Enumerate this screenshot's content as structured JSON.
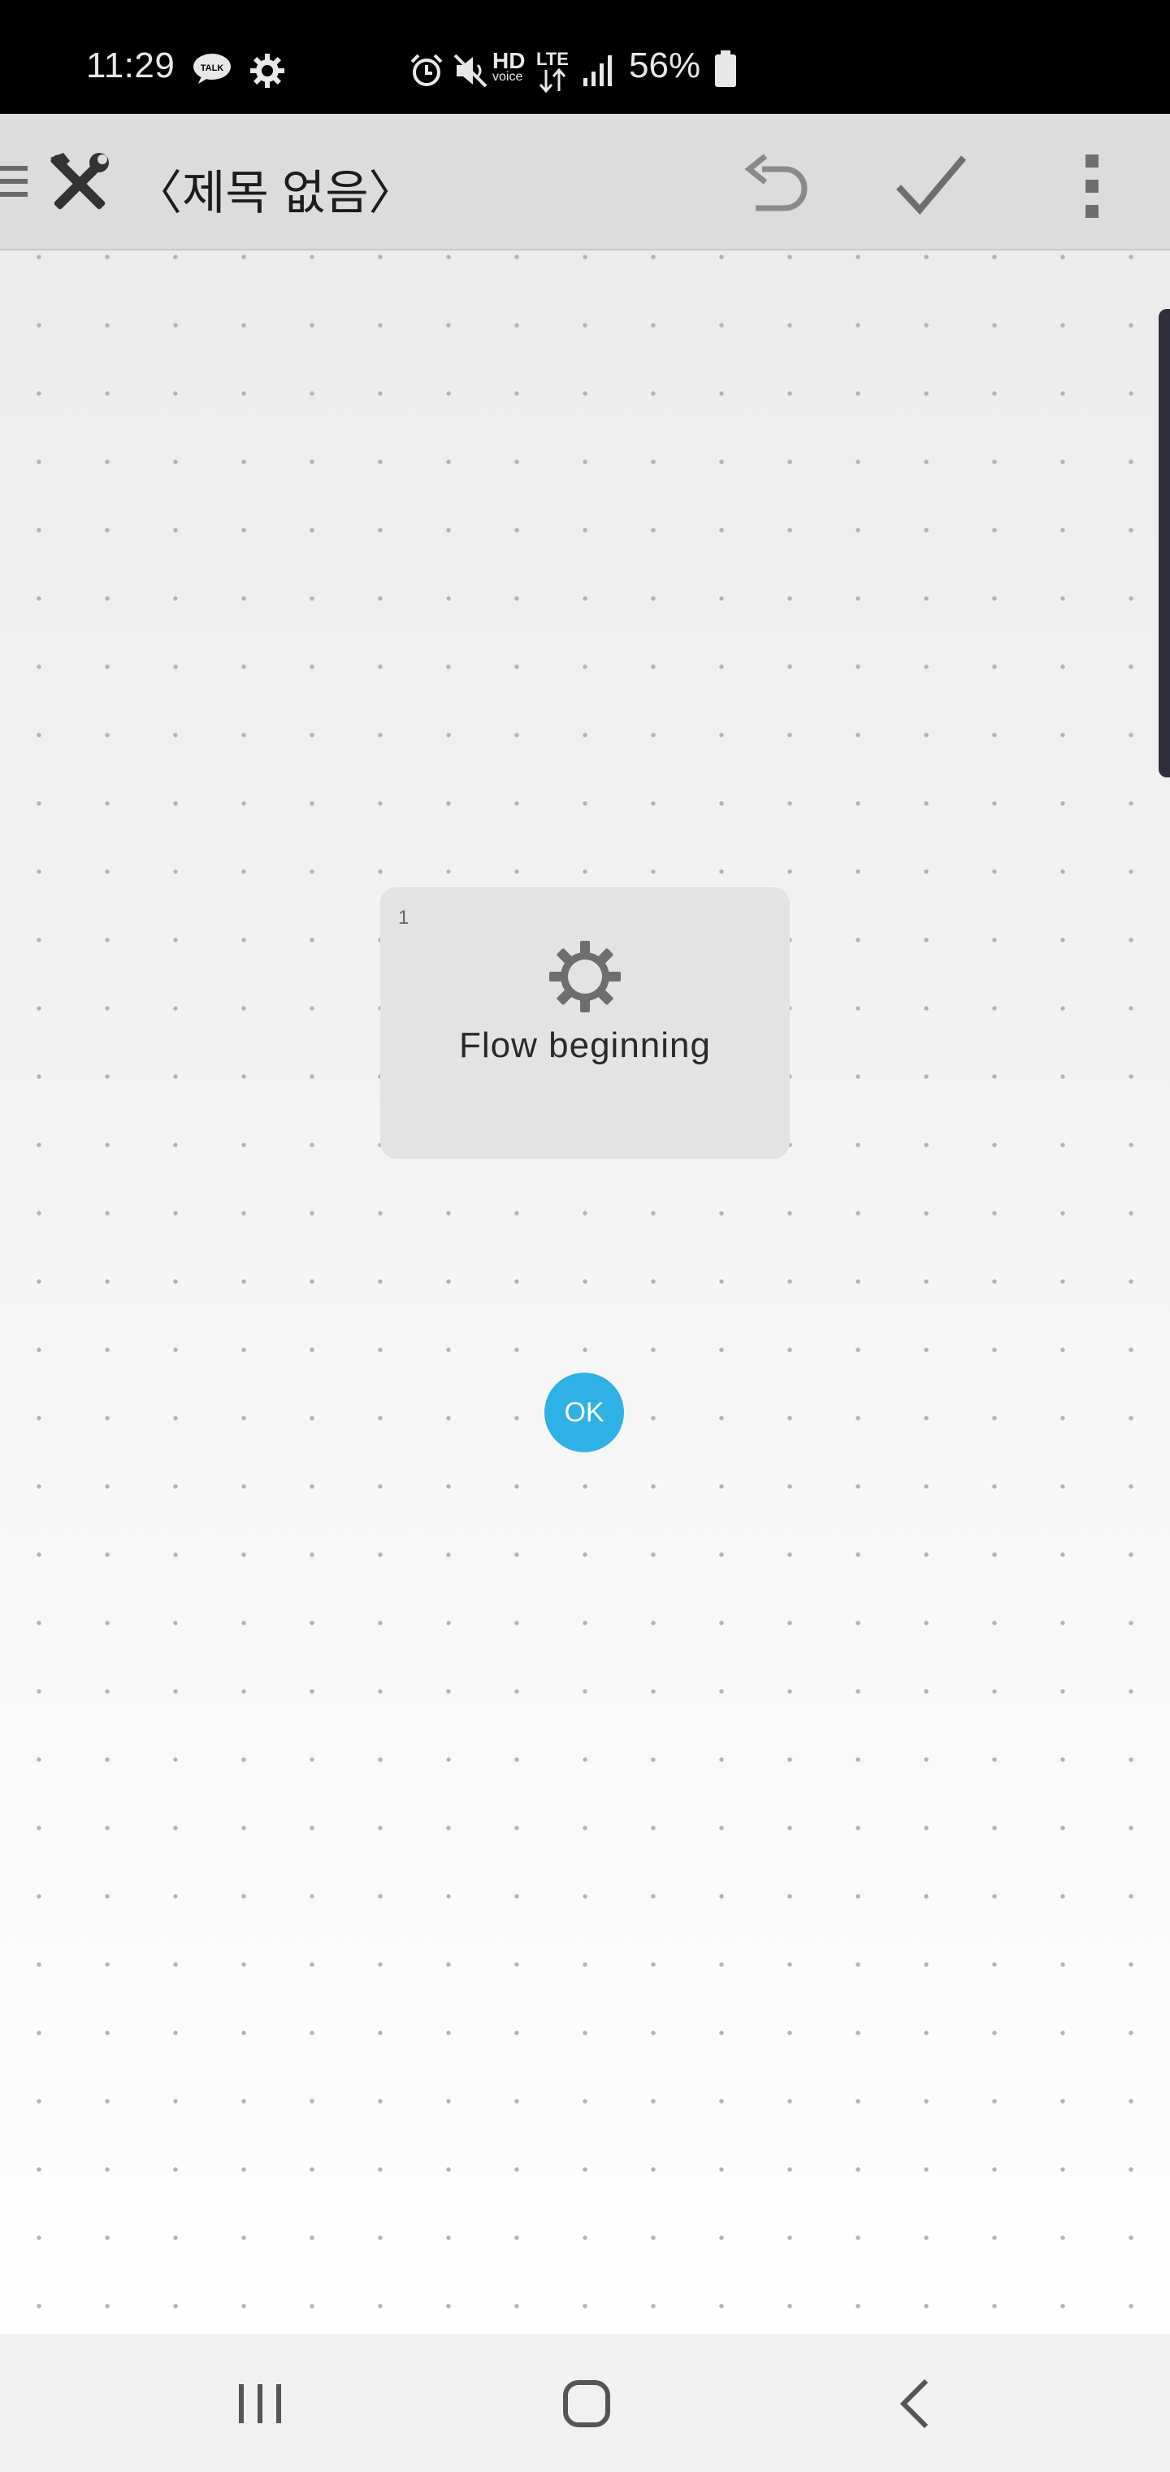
{
  "status_bar": {
    "time": "11:29",
    "talk_icon_text": "TALK",
    "hd_label": "HD",
    "hd_sub": "voice",
    "network": "LTE",
    "battery": "56%"
  },
  "app_bar": {
    "title": "〈제목 없음〉"
  },
  "flow_node": {
    "number": "1",
    "label": "Flow beginning",
    "button": "OK",
    "icon": "gear-icon"
  },
  "colors": {
    "accent": "#2fb1e6",
    "app_bar": "#dcdcdc",
    "status_bar": "#000000",
    "node_bg": "#e3e3e3"
  }
}
